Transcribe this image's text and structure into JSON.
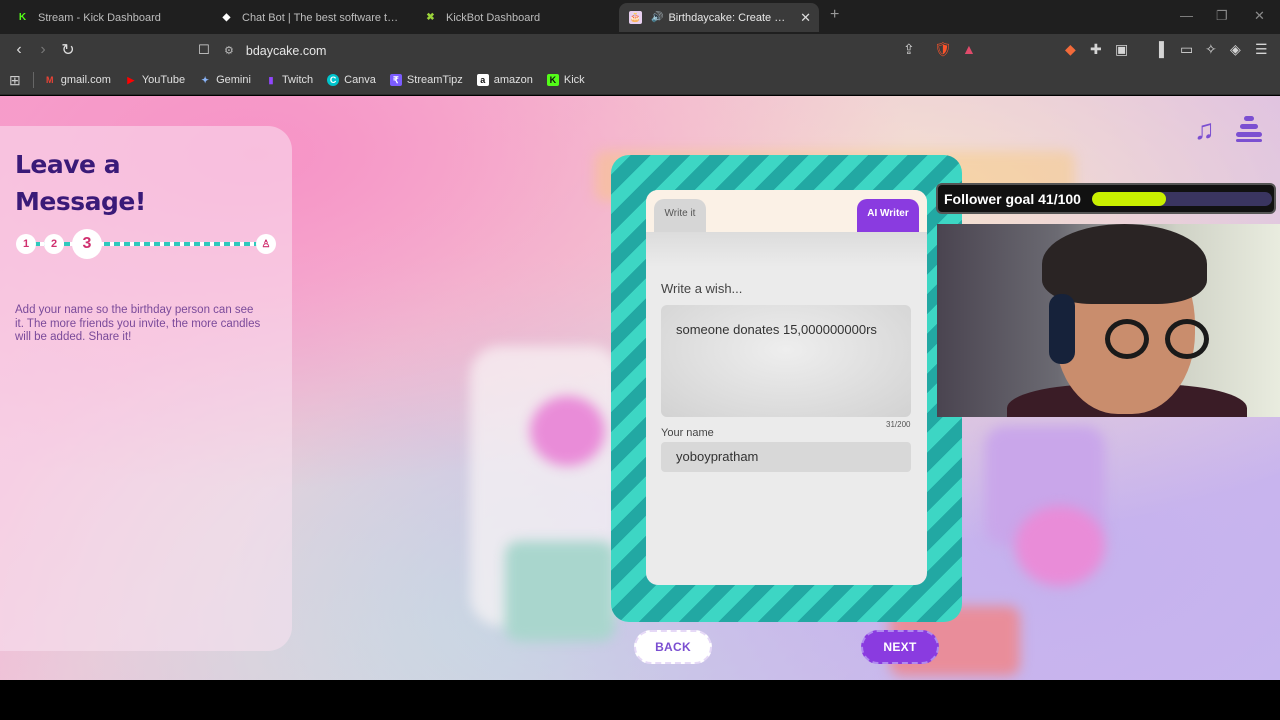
{
  "browser": {
    "tabs": [
      {
        "title": "Stream - Kick Dashboard",
        "favicon": "K",
        "favicon_color": "#53fc18",
        "active": false
      },
      {
        "title": "Chat Bot | The best software to boost",
        "favicon": "◆",
        "favicon_color": "#ffffff",
        "active": false
      },
      {
        "title": "KickBot Dashboard",
        "favicon": "✖",
        "favicon_color": "#9bd33a",
        "active": false
      },
      {
        "title": "Birthdaycake: Create & Share",
        "favicon": "🎂",
        "favicon_color": "#e8d0f0",
        "active": true
      }
    ],
    "url": "bdaycake.com",
    "bookmarks": [
      {
        "label": "gmail.com",
        "icon": "M",
        "color": "#ea4335"
      },
      {
        "label": "YouTube",
        "icon": "▶",
        "color": "#ff0000"
      },
      {
        "label": "Gemini",
        "icon": "✦",
        "color": "#8ab4f8"
      },
      {
        "label": "Twitch",
        "icon": "▮",
        "color": "#9146ff"
      },
      {
        "label": "Canva",
        "icon": "C",
        "color": "#00c4cc"
      },
      {
        "label": "StreamTipz",
        "icon": "₹",
        "color": "#7b5cff"
      },
      {
        "label": "amazon",
        "icon": "a",
        "color": "#ffffff"
      },
      {
        "label": "Kick",
        "icon": "K",
        "color": "#53fc18"
      }
    ]
  },
  "page": {
    "title": "Leave a Message!",
    "steps": [
      "1",
      "2",
      "3"
    ],
    "current_step": "3",
    "description": "Add your name so the birthday person can see it. The more friends you invite, the more candles will be added. Share it!",
    "card": {
      "tab_write": "Write it",
      "tab_ai": "AI Writer",
      "wish_label": "Write a wish...",
      "wish_value": "someone donates 15,000000000rs",
      "char_count": "31/200",
      "name_label": "Your name",
      "name_value": "yoboypratham"
    },
    "back_label": "BACK",
    "next_label": "NEXT"
  },
  "overlay": {
    "follower_goal_text": "Follower goal 41/100",
    "follower_goal_fraction": 0.41
  },
  "colors": {
    "accent_purple": "#8a3be0",
    "title_color": "#3a1a78",
    "teal": "#3dd6c4",
    "goal_fill": "#c9f000"
  }
}
